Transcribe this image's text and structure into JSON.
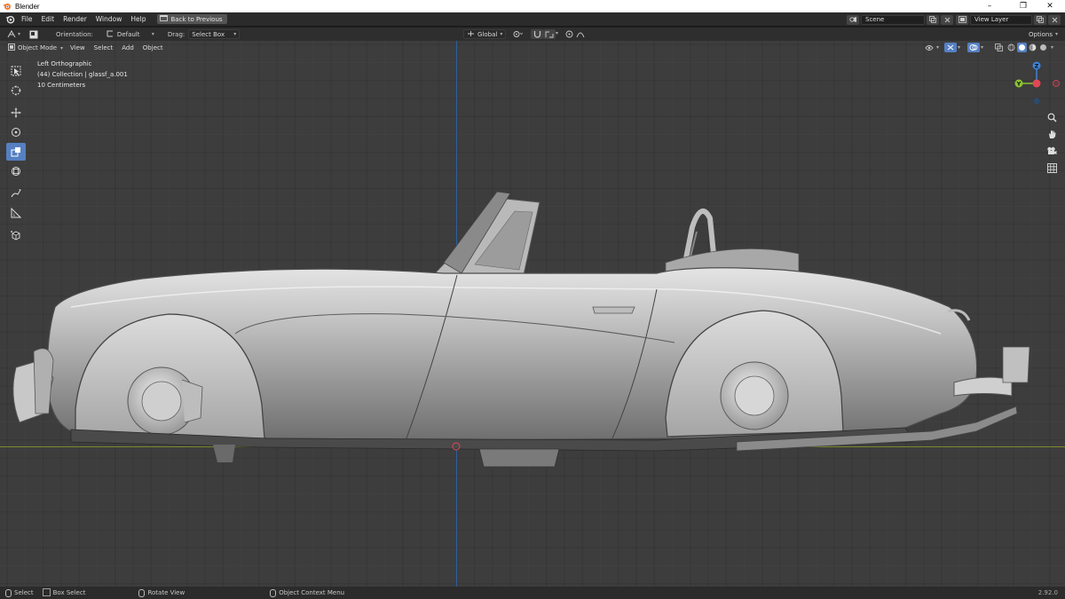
{
  "window": {
    "title": "Blender",
    "minimize": "–",
    "maximize": "❐",
    "close": "✕"
  },
  "menubar": {
    "items": [
      "File",
      "Edit",
      "Render",
      "Window",
      "Help"
    ],
    "back_button": "Back to Previous",
    "scene": "Scene",
    "view_layer": "View Layer"
  },
  "toolheader": {
    "orientation_label": "Orientation:",
    "orientation_value": "Default",
    "drag_label": "Drag:",
    "drag_value": "Select Box",
    "transform_orientation": "Global",
    "options": "Options"
  },
  "viewport_header": {
    "mode": "Object Mode",
    "menus": [
      "View",
      "Select",
      "Add",
      "Object"
    ]
  },
  "overlay": {
    "view_name": "Left Orthographic",
    "collection": "(44) Collection | glassf_a.001",
    "scale": "10 Centimeters"
  },
  "gizmo": {
    "z": "Z",
    "y": "Y"
  },
  "statusbar": {
    "select": "Select",
    "box_select": "Box Select",
    "rotate_view": "Rotate View",
    "context_menu": "Object Context Menu",
    "version": "2.92.0"
  },
  "colors": {
    "accent": "#5680c2",
    "axis_z": "#2c5f9e",
    "axis_y": "#7d8a2c",
    "gizmo_x": "#e04855",
    "gizmo_y": "#8bc230",
    "gizmo_z": "#3c84d8"
  }
}
